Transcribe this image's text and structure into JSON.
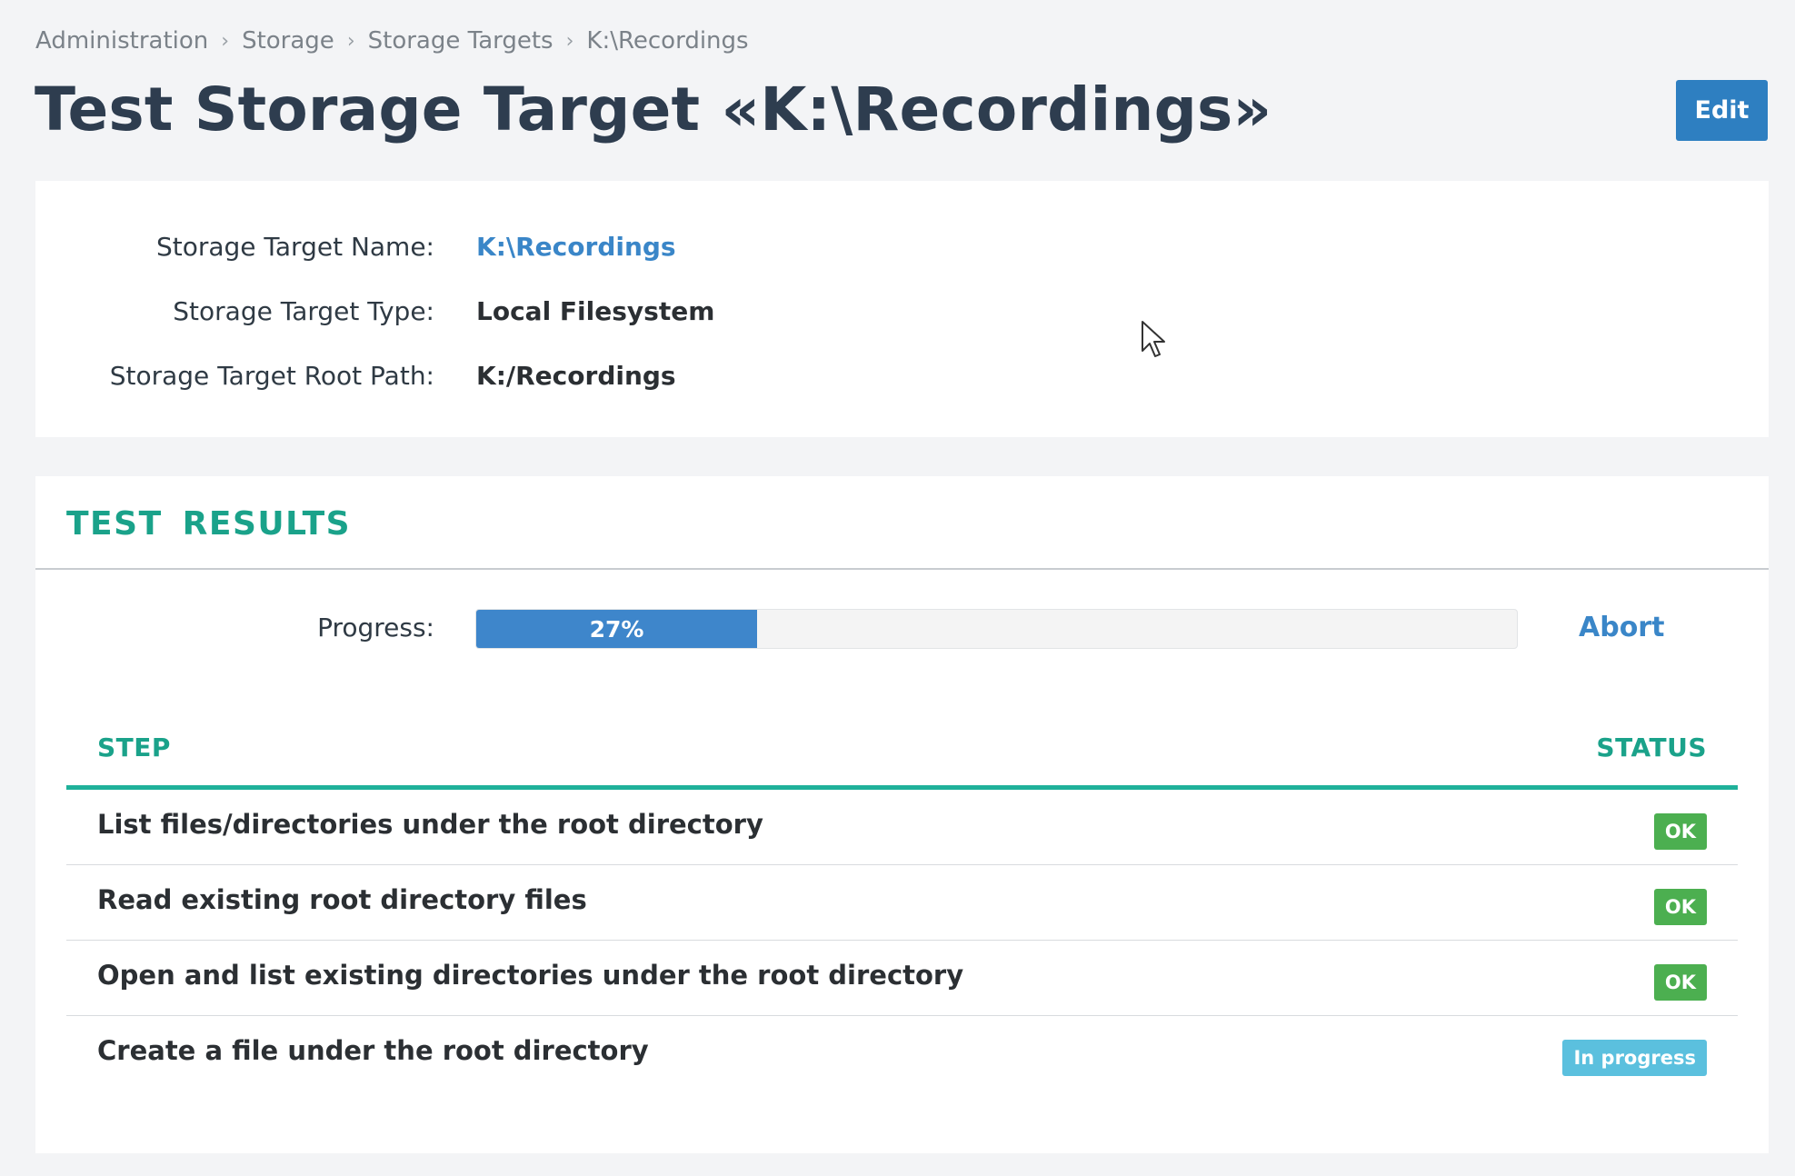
{
  "breadcrumb": {
    "items": [
      "Administration",
      "Storage",
      "Storage Targets",
      "K:\\Recordings"
    ]
  },
  "header": {
    "title": "Test Storage Target «K:\\Recordings»",
    "edit_label": "Edit"
  },
  "info": {
    "name_label": "Storage Target Name:",
    "name_value": "K:\\Recordings",
    "type_label": "Storage Target Type:",
    "type_value": "Local Filesystem",
    "path_label": "Storage Target Root Path:",
    "path_value": "K:/Recordings"
  },
  "results": {
    "title": "TEST RESULTS",
    "progress_label": "Progress:",
    "progress_percent": 27,
    "progress_text": "27%",
    "abort_label": "Abort",
    "columns": {
      "step": "STEP",
      "status": "STATUS"
    },
    "rows": [
      {
        "step": "List files/directories under the root directory",
        "status": "OK",
        "state": "ok"
      },
      {
        "step": "Read existing root directory files",
        "status": "OK",
        "state": "ok"
      },
      {
        "step": "Open and list existing directories under the root directory",
        "status": "OK",
        "state": "ok"
      },
      {
        "step": "Create a file under the root directory",
        "status": "In progress",
        "state": "progress"
      }
    ]
  },
  "colors": {
    "accent": "#2e7fc1",
    "link": "#3a86c8",
    "section_title": "#1aa28a",
    "ok": "#4caf50",
    "in_progress": "#5bc0de"
  },
  "icons": {
    "separator": "chevron-right-icon",
    "cursor": "mouse-pointer-icon"
  }
}
